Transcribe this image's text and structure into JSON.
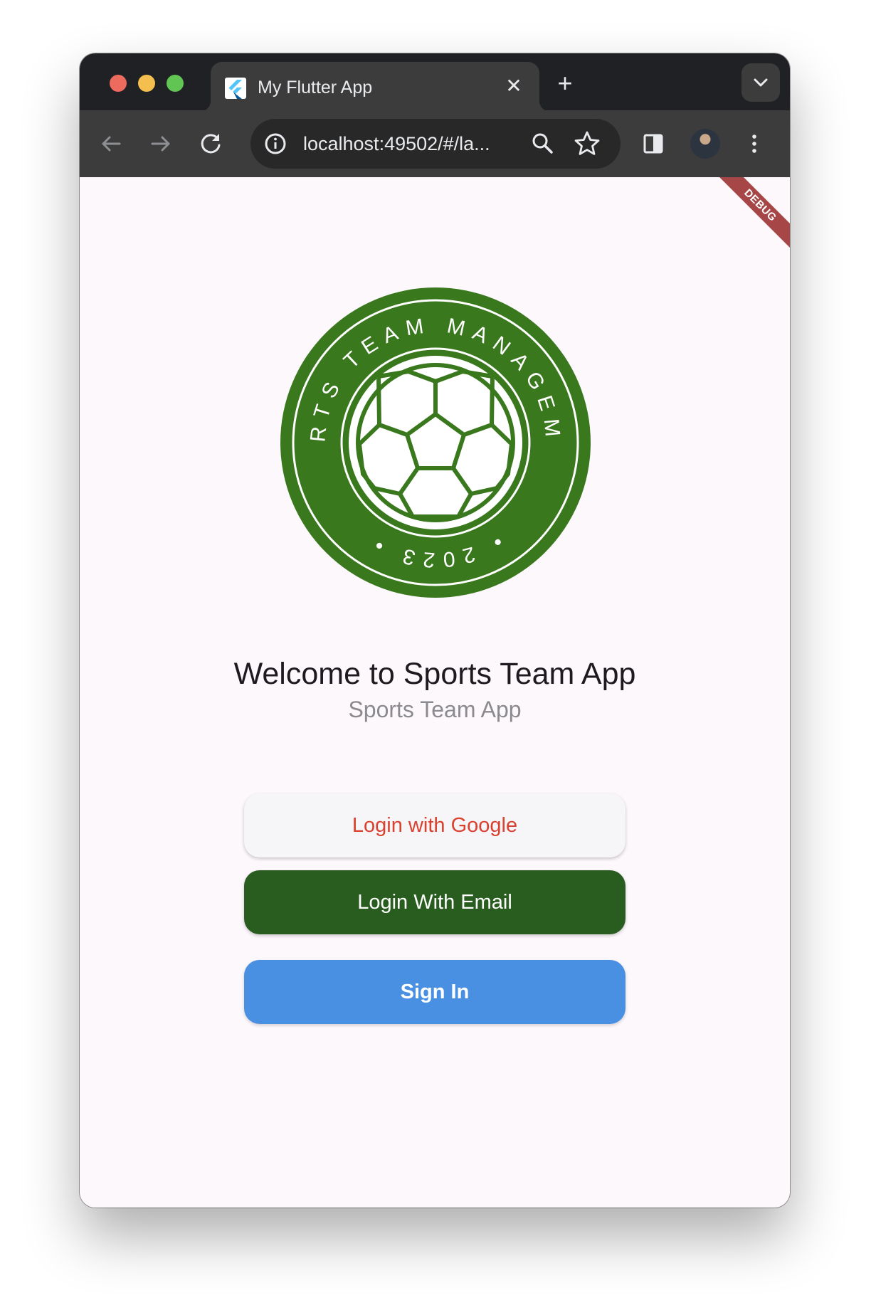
{
  "browser": {
    "tab_title": "My Flutter App",
    "address": "localhost:49502/#/la...",
    "icons": [
      "flutter-logo-icon",
      "close-icon",
      "plus-icon",
      "chevron-down-icon",
      "back-arrow-icon",
      "forward-arrow-icon",
      "reload-icon",
      "info-icon",
      "zoom-icon",
      "star-icon",
      "side-panel-icon",
      "avatar",
      "kebab-menu-icon"
    ]
  },
  "page": {
    "debug_banner": "DEBUG",
    "logo": {
      "ring_top_text": "SPORTS TEAM MANAGEMENT",
      "ring_bottom_text": "• 2023 •",
      "color": "#3a781e"
    },
    "title": "Welcome to Sports Team App",
    "subtitle": "Sports Team App",
    "buttons": {
      "google": "Login with Google",
      "email": "Login With Email",
      "sign_in": "Sign In"
    }
  },
  "colors": {
    "google_text": "#d9422e",
    "email_bg": "#295d1f",
    "sign_in_bg": "#4a90e2",
    "page_bg": "#fdf8fc"
  }
}
